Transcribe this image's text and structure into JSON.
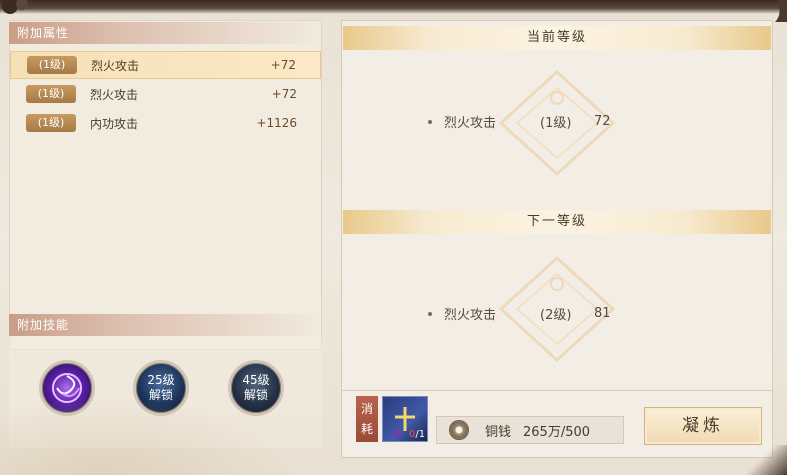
{
  "attributes": {
    "header": "附加属性",
    "rows": [
      {
        "level": "(1级)",
        "name": "烈火攻击",
        "value": "+72"
      },
      {
        "level": "(1级)",
        "name": "烈火攻击",
        "value": "+72"
      },
      {
        "level": "(1级)",
        "name": "内功攻击",
        "value": "+1126"
      }
    ]
  },
  "skills": {
    "header": "附加技能",
    "items": [
      {
        "line1": "",
        "line2": ""
      },
      {
        "line1": "25级",
        "line2": "解锁"
      },
      {
        "line1": "45级",
        "line2": "解锁"
      }
    ]
  },
  "current_level": {
    "header": "当前等级",
    "name": "烈火攻击",
    "level": "(1级)",
    "value": "72"
  },
  "next_level": {
    "header": "下一等级",
    "name": "烈火攻击",
    "level": "(2级)",
    "value": "81"
  },
  "cost": {
    "label_top": "消",
    "label_bottom": "耗",
    "material_have": "0",
    "material_need": "/1",
    "coin_label": "铜钱",
    "coin_value": "265万/500"
  },
  "refine_button": "凝炼",
  "colors": {
    "selected_row": "#fbe9c7",
    "badge": "#b8884f",
    "header_band": "#f7ead0"
  }
}
